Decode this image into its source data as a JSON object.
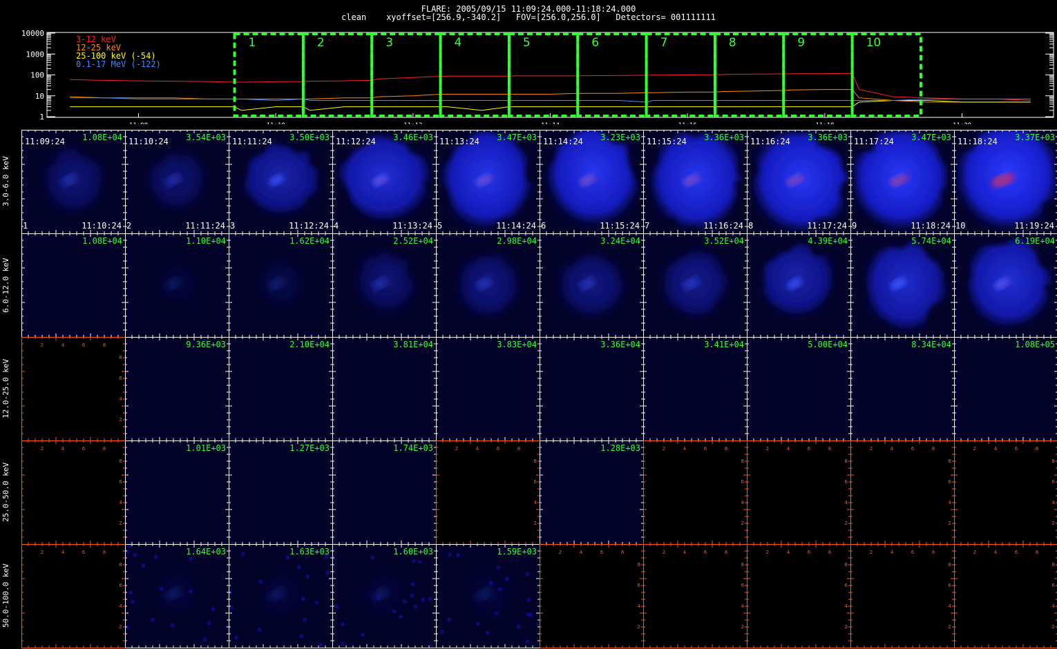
{
  "header": {
    "line1": "FLARE: 2005/09/15 11:09:24.000-11:18:24.000",
    "line2": "clean    xyoffset=[256.9,-340.2]   FOV=[256.0,256.0]   Detectors= 001111111"
  },
  "colors": {
    "green": "#33ff33",
    "red_axis": "#ff5522",
    "frame": "#ffffff"
  },
  "chart_data": [
    {
      "type": "line",
      "yscale": "log",
      "ylim": [
        1,
        10000
      ],
      "ytick_labels": [
        "10000",
        "1000",
        "100",
        "10",
        "1"
      ],
      "xlim_minutes": [
        11.12,
        11.35
      ],
      "xtick_labels": [
        "11:08",
        "11:10",
        "11:12",
        "11:14",
        "11:16",
        "11:18",
        "11:20"
      ],
      "x": [
        "11:07:00",
        "11:07:30",
        "11:08:00",
        "11:08:30",
        "11:09:00",
        "11:09:24",
        "11:09:30",
        "11:10:00",
        "11:10:24",
        "11:10:30",
        "11:11:00",
        "11:11:24",
        "11:11:30",
        "11:12:00",
        "11:12:24",
        "11:12:30",
        "11:13:00",
        "11:13:24",
        "11:13:30",
        "11:14:00",
        "11:14:24",
        "11:14:30",
        "11:15:00",
        "11:15:24",
        "11:15:30",
        "11:16:00",
        "11:16:24",
        "11:16:30",
        "11:17:00",
        "11:17:24",
        "11:17:30",
        "11:18:00",
        "11:18:24",
        "11:18:30",
        "11:19:00",
        "11:19:30",
        "11:20:00",
        "11:20:30",
        "11:21:00"
      ],
      "series": [
        {
          "name": "3-12 keV",
          "color": "#ff2020",
          "values": [
            60,
            55,
            52,
            50,
            48,
            45,
            45,
            47,
            48,
            50,
            52,
            55,
            65,
            75,
            85,
            88,
            88,
            88,
            90,
            90,
            90,
            92,
            94,
            96,
            98,
            100,
            102,
            105,
            110,
            112,
            114,
            116,
            118,
            20,
            9,
            8,
            7,
            7,
            6
          ]
        },
        {
          "name": "12-25 keV",
          "color": "#ff8c00",
          "values": [
            9,
            8,
            8,
            8,
            7,
            7,
            7,
            7,
            7,
            7,
            8,
            8,
            9,
            10,
            12,
            12,
            12,
            12,
            12,
            12,
            13,
            13,
            13,
            14,
            14,
            15,
            15,
            16,
            17,
            18,
            19,
            20,
            20,
            8,
            6,
            5,
            5,
            5,
            5
          ]
        },
        {
          "name": "25-100 keV (-54)",
          "color": "#ffff00",
          "values": [
            3,
            3,
            3,
            3,
            3,
            3,
            2,
            3,
            3,
            2,
            3,
            3,
            3,
            3,
            3,
            3,
            2,
            3,
            3,
            3,
            3,
            3,
            3,
            3,
            3,
            3,
            3,
            3,
            3,
            3,
            3,
            3,
            3,
            5,
            6,
            6,
            5,
            5,
            5
          ]
        },
        {
          "name": "0.1-17 MeV (-122)",
          "color": "#4488ff",
          "values": [
            8,
            8,
            7,
            7,
            7,
            7,
            7,
            6,
            7,
            6,
            6,
            6,
            6,
            6,
            6,
            6,
            6,
            6,
            6,
            6,
            6,
            6,
            6,
            5,
            6,
            6,
            6,
            6,
            6,
            6,
            6,
            6,
            6,
            6,
            6,
            7,
            7,
            7,
            7
          ]
        }
      ],
      "intervals": [
        "1",
        "2",
        "3",
        "4",
        "5",
        "6",
        "7",
        "8",
        "9",
        "10"
      ]
    },
    {
      "type": "heatmap",
      "rows": [
        "3.0-6.0 keV",
        "6.0-12.0 keV",
        "12.0-25.0 keV",
        "25.0-50.0 keV",
        "50.0-100.0 keV"
      ],
      "columns": [
        {
          "index": "1",
          "start": "11:09:24",
          "end": "11:10:24"
        },
        {
          "index": "2",
          "start": "11:10:24",
          "end": "11:11:24"
        },
        {
          "index": "3",
          "start": "11:11:24",
          "end": "11:12:24"
        },
        {
          "index": "4",
          "start": "11:12:24",
          "end": "11:13:24"
        },
        {
          "index": "5",
          "start": "11:13:24",
          "end": "11:14:24"
        },
        {
          "index": "6",
          "start": "11:14:24",
          "end": "11:15:24"
        },
        {
          "index": "7",
          "start": "11:15:24",
          "end": "11:16:24"
        },
        {
          "index": "8",
          "start": "11:16:24",
          "end": "11:17:24"
        },
        {
          "index": "9",
          "start": "11:17:24",
          "end": "11:18:24"
        },
        {
          "index": "10",
          "start": "11:18:24",
          "end": "11:19:24"
        }
      ],
      "peaks": [
        [
          "1.08E+04",
          "3.54E+03",
          "3.50E+03",
          "3.46E+03",
          "3.47E+03",
          "3.23E+03",
          "3.36E+03",
          "3.36E+03",
          "3.47E+03",
          "3.37E+03"
        ],
        [
          "1.08E+04",
          "1.10E+04",
          "1.62E+04",
          "2.52E+04",
          "2.98E+04",
          "3.24E+04",
          "3.52E+04",
          "4.39E+04",
          "5.74E+04",
          "6.19E+04"
        ],
        [
          "",
          "9.36E+03",
          "2.10E+04",
          "3.81E+04",
          "3.83E+04",
          "3.36E+04",
          "3.41E+04",
          "5.00E+04",
          "8.34E+04",
          "1.08E+05"
        ],
        [
          "",
          "1.01E+03",
          "1.27E+03",
          "1.74E+03",
          "",
          "1.28E+03",
          "",
          "",
          "",
          ""
        ],
        [
          "",
          "1.64E+03",
          "1.63E+03",
          "1.60E+03",
          "1.59E+03",
          "",
          "",
          "",
          "",
          ""
        ]
      ],
      "intensity": [
        [
          0.3,
          0.28,
          0.55,
          0.75,
          0.85,
          0.88,
          0.88,
          0.9,
          0.92,
          0.95
        ],
        [
          0.0,
          0.05,
          0.1,
          0.3,
          0.35,
          0.35,
          0.4,
          0.55,
          0.7,
          0.75
        ],
        [
          0.0,
          0.0,
          0.0,
          0.0,
          0.0,
          0.0,
          0.0,
          0.0,
          0.0,
          0.0
        ],
        [
          0.0,
          0.0,
          0.0,
          0.0,
          0.0,
          0.0,
          0.0,
          0.0,
          0.0,
          0.0
        ],
        [
          0.0,
          0.05,
          0.05,
          0.05,
          0.05,
          0.0,
          0.0,
          0.0,
          0.0,
          0.0
        ]
      ],
      "red_core": [
        [
          0.0,
          0.0,
          0.0,
          0.2,
          0.25,
          0.3,
          0.3,
          0.35,
          0.45,
          0.7
        ],
        [
          0.0,
          0.0,
          0.0,
          0.0,
          0.0,
          0.0,
          0.0,
          0.0,
          0.0,
          0.15
        ],
        [
          0,
          0,
          0,
          0,
          0,
          0,
          0,
          0,
          0,
          0
        ],
        [
          0,
          0,
          0,
          0,
          0,
          0,
          0,
          0,
          0,
          0
        ],
        [
          0,
          0,
          0,
          0,
          0,
          0,
          0,
          0,
          0,
          0
        ]
      ],
      "panel_fill": [
        [
          "blue",
          "blue",
          "blue",
          "blue",
          "blue",
          "blue",
          "blue",
          "blue",
          "blue",
          "blue"
        ],
        [
          "blue",
          "blue",
          "blue",
          "blue",
          "blue",
          "blue",
          "blue",
          "blue",
          "blue",
          "blue"
        ],
        [
          "black",
          "blue",
          "blue",
          "blue",
          "blue",
          "blue",
          "blue",
          "blue",
          "blue",
          "blue"
        ],
        [
          "black",
          "blue",
          "blue",
          "blue",
          "black",
          "blue",
          "black",
          "black",
          "black",
          "black"
        ],
        [
          "black",
          "blue",
          "blue",
          "blue",
          "blue",
          "black",
          "black",
          "black",
          "black",
          "black"
        ]
      ],
      "empty_axis_labels": [
        "2",
        "4",
        "6",
        "8"
      ]
    }
  ]
}
